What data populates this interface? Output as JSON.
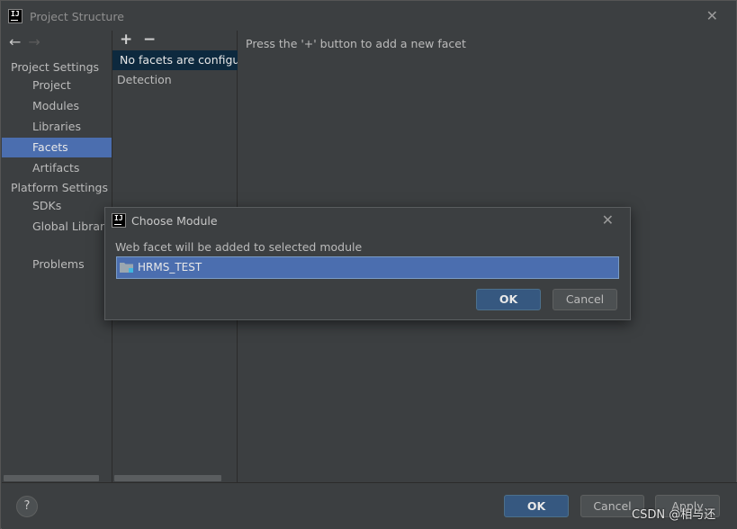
{
  "window": {
    "title": "Project Structure",
    "logo_icon": "intellij-logo-icon",
    "logo_text": "IJ"
  },
  "sidebar": {
    "project_settings_label": "Project Settings",
    "project_items": [
      "Project",
      "Modules",
      "Libraries",
      "Facets",
      "Artifacts"
    ],
    "platform_settings_label": "Platform Settings",
    "platform_items": [
      "SDKs",
      "Global Libraries"
    ],
    "problems_label": "Problems",
    "selected": "Facets"
  },
  "facets": {
    "selected_row": "No facets are configured",
    "detection": "Detection",
    "hint": "Press the '+' button to add a new facet"
  },
  "modal": {
    "title": "Choose Module",
    "message": "Web facet will be added to selected module",
    "module": "HRMS_TEST",
    "ok_label": "OK",
    "cancel_label": "Cancel"
  },
  "footer": {
    "help_label": "?",
    "ok_label": "OK",
    "cancel_label": "Cancel",
    "apply_label": "Apply"
  },
  "watermark": "CSDN @相与还",
  "colors": {
    "selection": "#4b6eaf",
    "background": "#3c3f41",
    "primary_button": "#365880"
  }
}
